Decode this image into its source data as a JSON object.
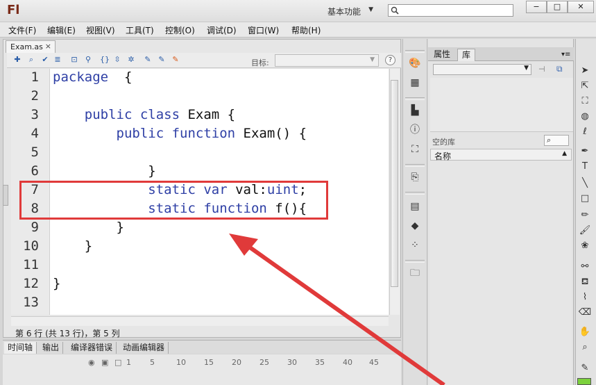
{
  "title_bar": {
    "app_logo": "Fl",
    "workspace": "基本功能",
    "window_buttons": [
      "−",
      "□",
      "✕"
    ]
  },
  "menu": [
    "文件(F)",
    "编辑(E)",
    "视图(V)",
    "工具(T)",
    "控制(O)",
    "调试(D)",
    "窗口(W)",
    "帮助(H)"
  ],
  "editor": {
    "tab_label": "Exam.as",
    "tab_close": "×",
    "target_label": "目标:",
    "help": "?",
    "line_numbers": [
      "1",
      "2",
      "3",
      "4",
      "5",
      "6",
      "7",
      "8",
      "9",
      "10",
      "11",
      "12",
      "13"
    ],
    "lines": [
      {
        "kw": "package",
        "rest": "  {"
      },
      {
        "kw": "",
        "rest": ""
      },
      {
        "kw": "    public class",
        "rest": " Exam {"
      },
      {
        "kw": "        public function",
        "rest": " Exam() {"
      },
      {
        "kw": "",
        "rest": ""
      },
      {
        "kw": "",
        "rest": "            }"
      },
      {
        "kw": "            static var",
        "rest": " val:",
        "type": "uint",
        "tail": ";"
      },
      {
        "kw": "            static function",
        "rest": " f(){"
      },
      {
        "kw": "",
        "rest": "        }"
      },
      {
        "kw": "",
        "rest": "    }"
      },
      {
        "kw": "",
        "rest": ""
      },
      {
        "kw": "",
        "rest": "}"
      },
      {
        "kw": "",
        "rest": ""
      }
    ],
    "status": "第 6 行 (共 13 行)，第 5 列"
  },
  "bottom_panel": {
    "tabs": [
      "时间轴",
      "输出",
      "编译器错误",
      "动画编辑器"
    ],
    "frame_ticks": [
      "1",
      "5",
      "10",
      "15",
      "20",
      "25",
      "30",
      "35",
      "40",
      "45"
    ]
  },
  "library": {
    "tabs": [
      "属性",
      "库"
    ],
    "empty_label": "空的库",
    "column_header": "名称"
  },
  "colors": {
    "keyword": "#2e3fa5",
    "annotation_red": "#e03a3a",
    "fill_swatch": "#7cd13c"
  }
}
